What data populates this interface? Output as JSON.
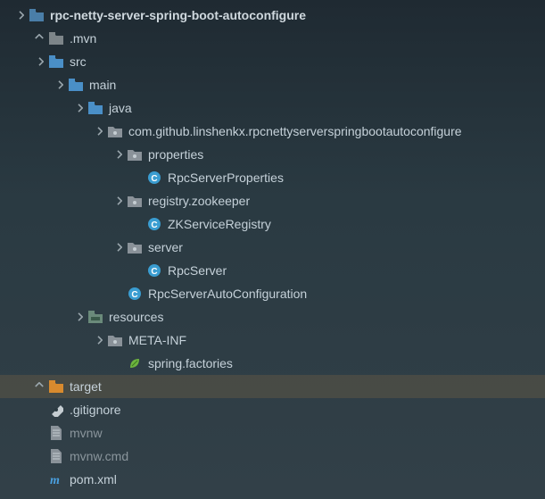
{
  "tree": {
    "nodes": [
      {
        "indent": 0,
        "arrow": "down",
        "icon": "folder-module",
        "label": "rpc-netty-server-spring-boot-autoconfigure",
        "bold": true
      },
      {
        "indent": 1,
        "arrow": "right",
        "icon": "folder-gray",
        "label": ".mvn"
      },
      {
        "indent": 1,
        "arrow": "down",
        "icon": "folder-blue",
        "label": "src"
      },
      {
        "indent": 2,
        "arrow": "down",
        "icon": "folder-blue",
        "label": "main"
      },
      {
        "indent": 3,
        "arrow": "down",
        "icon": "folder-blue",
        "label": "java"
      },
      {
        "indent": 4,
        "arrow": "down",
        "icon": "package",
        "label": "com.github.linshenkx.rpcnettyserverspringbootautoconfigure"
      },
      {
        "indent": 5,
        "arrow": "down",
        "icon": "package",
        "label": "properties"
      },
      {
        "indent": 6,
        "arrow": "none",
        "icon": "class",
        "label": "RpcServerProperties"
      },
      {
        "indent": 5,
        "arrow": "down",
        "icon": "package",
        "label": "registry.zookeeper"
      },
      {
        "indent": 6,
        "arrow": "none",
        "icon": "class",
        "label": "ZKServiceRegistry"
      },
      {
        "indent": 5,
        "arrow": "down",
        "icon": "package",
        "label": "server"
      },
      {
        "indent": 6,
        "arrow": "none",
        "icon": "class",
        "label": "RpcServer"
      },
      {
        "indent": 5,
        "arrow": "none",
        "icon": "class",
        "label": "RpcServerAutoConfiguration"
      },
      {
        "indent": 3,
        "arrow": "down",
        "icon": "folder-resources",
        "label": "resources"
      },
      {
        "indent": 4,
        "arrow": "down",
        "icon": "package",
        "label": "META-INF"
      },
      {
        "indent": 5,
        "arrow": "none",
        "icon": "leaf",
        "label": "spring.factories"
      },
      {
        "indent": 1,
        "arrow": "right",
        "icon": "folder-orange",
        "label": "target",
        "selected": true
      },
      {
        "indent": 1,
        "arrow": "none",
        "icon": "gitignore",
        "label": ".gitignore"
      },
      {
        "indent": 1,
        "arrow": "none",
        "icon": "file",
        "label": "mvnw",
        "muted": true
      },
      {
        "indent": 1,
        "arrow": "none",
        "icon": "file",
        "label": "mvnw.cmd",
        "muted": true
      },
      {
        "indent": 1,
        "arrow": "none",
        "icon": "maven",
        "label": "pom.xml"
      }
    ]
  }
}
